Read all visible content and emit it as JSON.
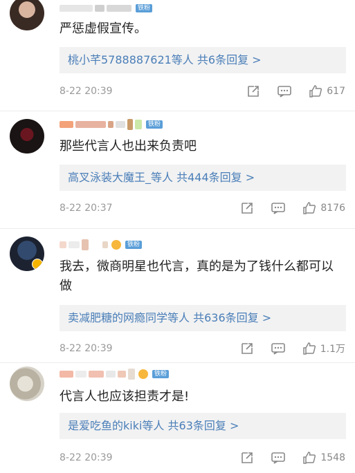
{
  "comments": [
    {
      "text": "严惩虚假宣传。",
      "reply_summary": "桃小芊5788887621等人 共6条回复 >",
      "time": "8-22 20:39",
      "likes": "617",
      "badge": "铁粉"
    },
    {
      "text": "那些代言人也出来负责吧",
      "reply_summary": "高叉泳装大魔王_等人 共444条回复 >",
      "time": "8-22 20:37",
      "likes": "8176",
      "badge": "铁粉"
    },
    {
      "text": "我去，微商明星也代言，真的是为了钱什么都可以做",
      "reply_summary": "卖减肥糖的网瘾同学等人 共636条回复 >",
      "time": "8-22 20:39",
      "likes": "1.1万",
      "badge": "铁粉"
    },
    {
      "text": "代言人也应该担责才是!",
      "reply_summary": "是爱吃鱼的kiki等人 共63条回复 >",
      "time": "8-22 20:39",
      "likes": "1548",
      "badge": "铁粉"
    }
  ]
}
